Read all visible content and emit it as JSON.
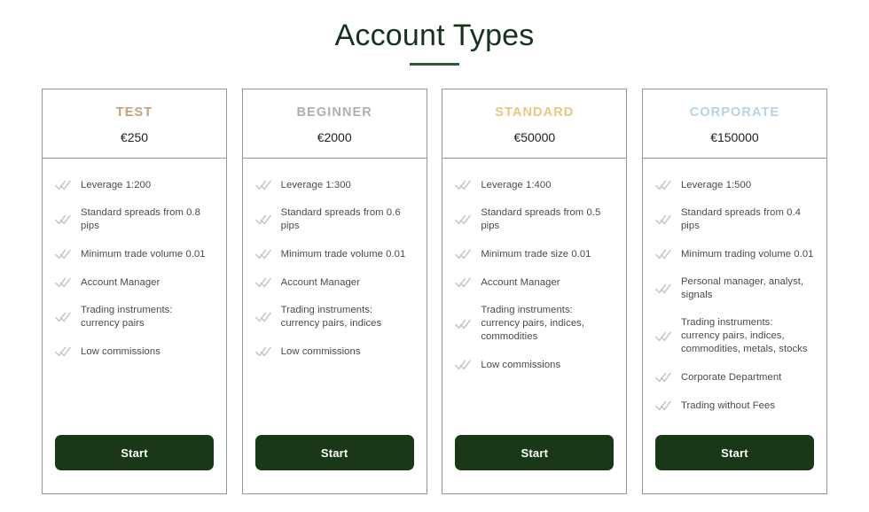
{
  "header": {
    "title": "Account Types",
    "accent_color": "#2f5a36"
  },
  "icons": {
    "check": "double-check-icon"
  },
  "cards": [
    {
      "plan": "TEST",
      "plan_color": "#c5a172",
      "price": "€250",
      "features": [
        "Leverage 1:200",
        "Standard spreads from 0.8 pips",
        "Minimum trade volume 0.01",
        "Account Manager",
        "Trading instruments: currency pairs",
        "Low commissions"
      ],
      "cta": "Start"
    },
    {
      "plan": "BEGINNER",
      "plan_color": "#a9b1b6",
      "price": "€2000",
      "features": [
        "Leverage 1:300",
        "Standard spreads from 0.6 pips",
        "Minimum trade volume 0.01",
        "Account Manager",
        "Trading instruments: currency pairs, indices",
        "Low commissions"
      ],
      "cta": "Start"
    },
    {
      "plan": "STANDARD",
      "plan_color": "#e8c87c",
      "price": "€50000",
      "features": [
        "Leverage 1:400",
        "Standard spreads from 0.5 pips",
        "Minimum trade size 0.01",
        "Account Manager",
        "Trading instruments: currency pairs, indices, commodities",
        "Low commissions"
      ],
      "cta": "Start"
    },
    {
      "plan": "CORPORATE",
      "plan_color": "#b4d3e6",
      "price": "€150000",
      "features": [
        "Leverage 1:500",
        "Standard spreads from 0.4 pips",
        "Minimum trading volume 0.01",
        "Personal manager, analyst, signals",
        "Trading instruments: currency pairs, indices, commodities, metals, stocks",
        "Corporate Department",
        "Trading without Fees"
      ],
      "cta": "Start"
    }
  ]
}
